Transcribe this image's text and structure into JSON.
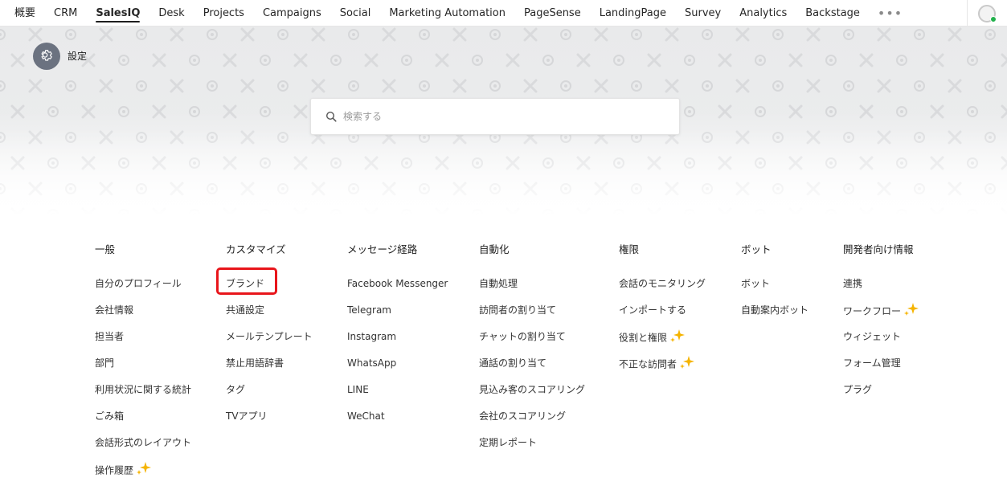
{
  "topnav": {
    "items": [
      "概要",
      "CRM",
      "SalesIQ",
      "Desk",
      "Projects",
      "Campaigns",
      "Social",
      "Marketing Automation",
      "PageSense",
      "LandingPage",
      "Survey",
      "Analytics",
      "Backstage"
    ],
    "active": "SalesIQ",
    "more_icon": "more-dots-icon"
  },
  "header": {
    "title": "設定",
    "icon": "gear-icon"
  },
  "search": {
    "placeholder": "検索する",
    "icon": "search-icon"
  },
  "columns": [
    {
      "title": "一般",
      "items": [
        {
          "label": "自分のプロフィール"
        },
        {
          "label": "会社情報"
        },
        {
          "label": "担当者"
        },
        {
          "label": "部門"
        },
        {
          "label": "利用状況に関する統計"
        },
        {
          "label": "ごみ箱"
        },
        {
          "label": "会話形式のレイアウト"
        },
        {
          "label": "操作履歴",
          "sparkle": true
        }
      ]
    },
    {
      "title": "カスタマイズ",
      "items": [
        {
          "label": "ブランド",
          "highlighted": true
        },
        {
          "label": "共通設定"
        },
        {
          "label": "メールテンプレート"
        },
        {
          "label": "禁止用語辞書"
        },
        {
          "label": "タグ"
        },
        {
          "label": "TVアプリ"
        }
      ]
    },
    {
      "title": "メッセージ経路",
      "items": [
        {
          "label": "Facebook Messenger"
        },
        {
          "label": "Telegram"
        },
        {
          "label": "Instagram"
        },
        {
          "label": "WhatsApp"
        },
        {
          "label": "LINE"
        },
        {
          "label": "WeChat"
        }
      ]
    },
    {
      "title": "自動化",
      "items": [
        {
          "label": "自動処理"
        },
        {
          "label": "訪問者の割り当て"
        },
        {
          "label": "チャットの割り当て"
        },
        {
          "label": "通話の割り当て"
        },
        {
          "label": "見込み客のスコアリング"
        },
        {
          "label": "会社のスコアリング"
        },
        {
          "label": "定期レポート"
        }
      ]
    },
    {
      "title": "権限",
      "items": [
        {
          "label": "会話のモニタリング"
        },
        {
          "label": "インポートする"
        },
        {
          "label": "役割と権限",
          "sparkle": true
        },
        {
          "label": "不正な訪問者",
          "sparkle": true
        }
      ]
    },
    {
      "title": "ボット",
      "items": [
        {
          "label": "ボット"
        },
        {
          "label": "自動案内ボット"
        }
      ]
    },
    {
      "title": "開発者向け情報",
      "items": [
        {
          "label": "連携"
        },
        {
          "label": "ワークフロー",
          "sparkle": true
        },
        {
          "label": "ウィジェット"
        },
        {
          "label": "フォーム管理"
        },
        {
          "label": "プラグ"
        }
      ]
    }
  ],
  "colors": {
    "highlight": "#e8151b",
    "sparkle": "#f5b400",
    "status_online": "#22b14c",
    "settings_badge": "#6b7280"
  }
}
